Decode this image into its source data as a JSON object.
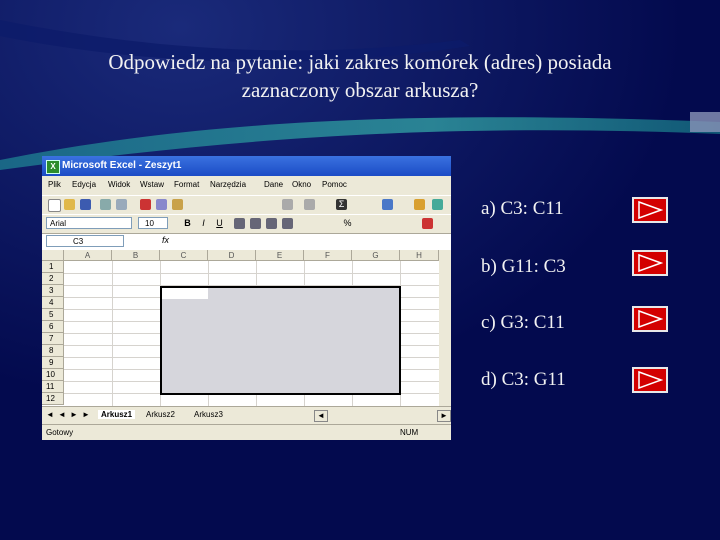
{
  "question": {
    "line1": "Odpowiedz na pytanie: jaki zakres komórek (adres) posiada",
    "line2": "zaznaczony obszar arkusza?"
  },
  "excel": {
    "title": "Microsoft Excel - Zeszyt1",
    "menu": [
      "Plik",
      "Edycja",
      "Widok",
      "Wstaw",
      "Format",
      "Narzędzia",
      "Dane",
      "Okno",
      "Pomoc"
    ],
    "font_name": "Arial",
    "font_size": "10",
    "name_box": "C3",
    "fx": "fx",
    "columns": [
      "A",
      "B",
      "C",
      "D",
      "E",
      "F",
      "G",
      "H"
    ],
    "rows": [
      "1",
      "2",
      "3",
      "4",
      "5",
      "6",
      "7",
      "8",
      "9",
      "10",
      "11",
      "12"
    ],
    "sheets": [
      "Arkusz1",
      "Arkusz2",
      "Arkusz3"
    ],
    "status_left": "Gotowy",
    "status_right": "NUM"
  },
  "answers": [
    {
      "label": "a) C3: C11",
      "icon": "play-triangle-icon"
    },
    {
      "label": "b) G11: C3",
      "icon": "play-triangle-icon"
    },
    {
      "label": "c) G3: C11",
      "icon": "play-triangle-icon"
    },
    {
      "label": "d) C3: G11",
      "icon": "play-triangle-icon"
    }
  ],
  "colors": {
    "background": "#030a4e",
    "button": "#d30000",
    "text": "#f2f2f2"
  }
}
